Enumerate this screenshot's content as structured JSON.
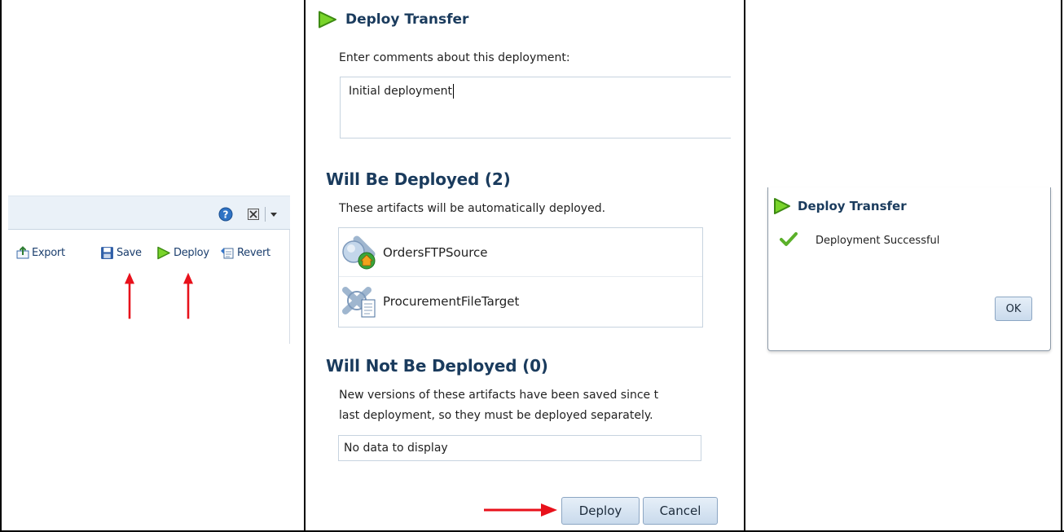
{
  "left_panel": {
    "toolbar": {
      "export_label": "Export",
      "save_label": "Save",
      "deploy_label": "Deploy",
      "revert_label": "Revert"
    }
  },
  "deploy_dialog": {
    "title": "Deploy Transfer",
    "comments_label": "Enter comments about this deployment:",
    "comments_value": "Initial deployment",
    "will_deploy_heading": "Will Be Deployed (2)",
    "will_deploy_desc": "These artifacts will be automatically deployed.",
    "artifacts": [
      {
        "name": "OrdersFTPSource",
        "icon": "ftp-source-icon"
      },
      {
        "name": "ProcurementFileTarget",
        "icon": "file-target-icon"
      }
    ],
    "will_not_deploy_heading": "Will Not Be Deployed (0)",
    "will_not_deploy_desc_line1": "New versions of these artifacts have been saved since t",
    "will_not_deploy_desc_line2": "last deployment, so they must be deployed separately.",
    "no_data": "No data to display",
    "deploy_button": "Deploy",
    "cancel_button": "Cancel"
  },
  "result_dialog": {
    "title": "Deploy Transfer",
    "message": "Deployment Successful",
    "ok_button": "OK"
  },
  "colors": {
    "arrow": "#e8111b",
    "title": "#1a3b5d",
    "toolbar_bg": "#eaf1f8",
    "deploy_icon": "#6fcf1f"
  }
}
